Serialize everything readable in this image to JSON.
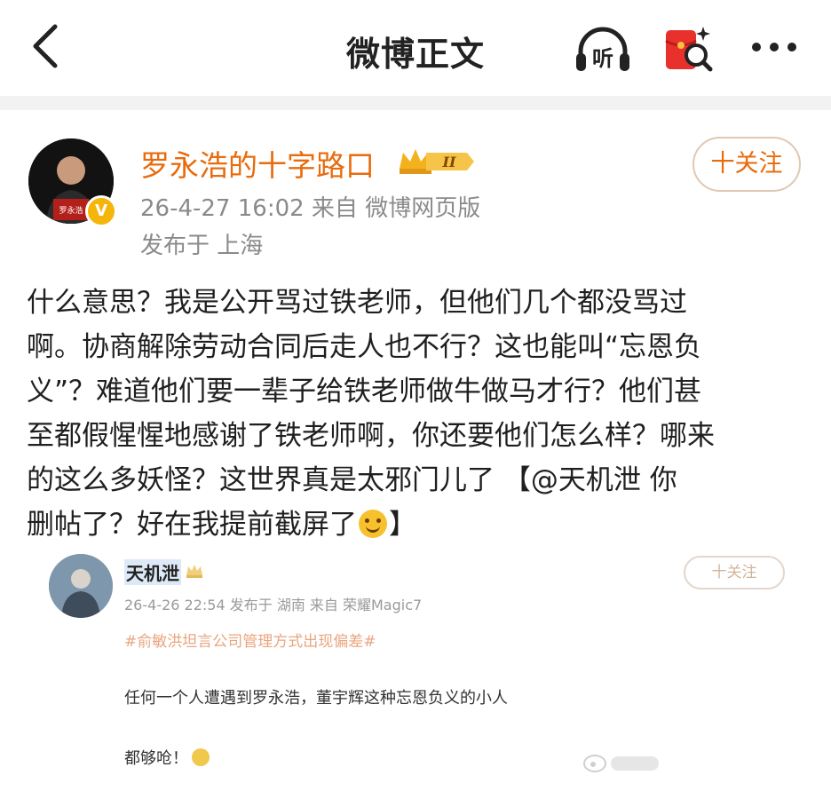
{
  "header": {
    "title": "微博正文",
    "listen_label": "听"
  },
  "post": {
    "author": "罗永浩的十字路口",
    "level_badge": "II",
    "time_source": "26-4-27 16:02   来自 微博网页版",
    "location": "发布于 上海",
    "follow_label": "十关注",
    "avatar_caption": "罗永浩",
    "body_lines": [
      "什么意思？我是公开骂过铁老师，但他们几个都没骂过",
      "啊。协商解除劳动合同后走人也不行？这也能叫“忘恩负",
      "义”？难道他们要一辈子给铁老师做牛做马才行？他们甚",
      "至都假惺惺地感谢了铁老师啊，你还要他们怎么样？哪来",
      "的这么多妖怪？这世界真是太邪门儿了          【@天机泄 你",
      "删帖了？好在我提前截屏了",
      "】"
    ]
  },
  "quoted": {
    "author": "天机泄",
    "meta": "26-4-26 22:54  发布于 湖南  来自 荣耀Magic7",
    "topic": "#俞敏洪坦言公司管理方式出现偏差#",
    "follow_label": "十关注",
    "text_line1": "任何一个人遭遇到罗永浩，董宇辉这种忘恩负义的小人",
    "text_line2": "都够呛！"
  },
  "colors": {
    "accent_orange": "#e86b0c",
    "meta_gray": "#8a8a8a",
    "separator": "#f2f2f2"
  },
  "icons": [
    "back-arrow-icon",
    "headphones-icon",
    "red-envelope-icon",
    "more-icon",
    "crown-icon",
    "verified-v-icon",
    "smile-emoji-icon",
    "weibo-watermark-icon"
  ]
}
